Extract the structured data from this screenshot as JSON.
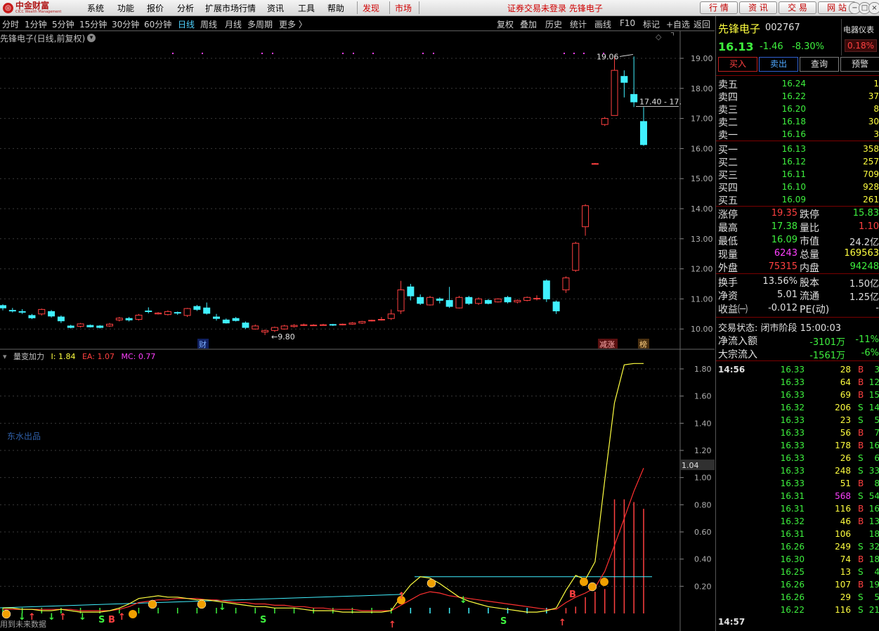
{
  "menubar": {
    "logo_text": "中金财富",
    "logo_sub": "CICC Wealth Management",
    "items": [
      "系统",
      "功能",
      "报价",
      "分析",
      "扩展市场行情",
      "资讯",
      "工具",
      "帮助"
    ],
    "faxian": "发现",
    "shichang": "市场",
    "notice": "证券交易未登录  先锋电子",
    "right_buttons": [
      "行 情",
      "资 讯",
      "交 易",
      "网 站"
    ],
    "win_buttons": [
      "−",
      "□",
      "×"
    ]
  },
  "toolbar": {
    "periods": [
      "分时",
      "1分钟",
      "5分钟",
      "15分钟",
      "30分钟",
      "60分钟",
      "日线",
      "周线",
      "月线",
      "多周期",
      "更多 〉"
    ],
    "active_period": "日线",
    "tools": [
      "复权",
      "叠加",
      "历史",
      "统计",
      "画线",
      "F10",
      "标记",
      "+自选",
      "返回"
    ]
  },
  "kline": {
    "title": "先锋电子(日线,前复权)",
    "high_label": "19.06",
    "low_label": "9.80",
    "range_label": "17.40 - 17.",
    "badge_cai": "财",
    "badge_jianzhang": "减涨",
    "badge_bang": "榜",
    "y_ticks": [
      "19.00",
      "18.00",
      "17.00",
      "16.00",
      "15.00",
      "14.00",
      "13.00",
      "12.00",
      "11.00",
      "10.00"
    ]
  },
  "indicator": {
    "name": "量变加力",
    "legend": [
      {
        "text": "I: 1.84",
        "color": "#ffff40"
      },
      {
        "text": "EA: 1.07",
        "color": "#ff4040"
      },
      {
        "text": "MC: 0.77",
        "color": "#ff40ff"
      }
    ],
    "y_ticks": [
      "1.80",
      "1.60",
      "1.40",
      "1.20",
      "1.00",
      "0.80",
      "0.60",
      "0.40",
      "0.20"
    ],
    "cursor_value": "1.04",
    "watermark": "东水出品",
    "footnote": "用到未来数据"
  },
  "quote": {
    "name": "先锋电子",
    "code": "002767",
    "price": "16.13",
    "change": "-1.46",
    "change_pct": "-8.30%",
    "meter_label": "电器仪表",
    "meter_value": "0.18%",
    "buttons": [
      "买入",
      "卖出",
      "查询",
      "预警"
    ],
    "asks": [
      {
        "label": "卖五",
        "price": "16.24",
        "vol": "1"
      },
      {
        "label": "卖四",
        "price": "16.22",
        "vol": "37"
      },
      {
        "label": "卖三",
        "price": "16.20",
        "vol": "8"
      },
      {
        "label": "卖二",
        "price": "16.18",
        "vol": "30"
      },
      {
        "label": "卖一",
        "price": "16.16",
        "vol": "3"
      }
    ],
    "bids": [
      {
        "label": "买一",
        "price": "16.13",
        "vol": "358"
      },
      {
        "label": "买二",
        "price": "16.12",
        "vol": "257"
      },
      {
        "label": "买三",
        "price": "16.11",
        "vol": "709"
      },
      {
        "label": "买四",
        "price": "16.10",
        "vol": "928"
      },
      {
        "label": "买五",
        "price": "16.09",
        "vol": "261"
      }
    ],
    "stats": [
      {
        "l1": "涨停",
        "v1": "19.35",
        "c1": "#ff4040",
        "l2": "跌停",
        "v2": "15.83",
        "c2": "#3ef03e"
      },
      {
        "l1": "最高",
        "v1": "17.38",
        "c1": "#3ef03e",
        "l2": "量比",
        "v2": "1.10",
        "c2": "#ff4040"
      },
      {
        "l1": "最低",
        "v1": "16.09",
        "c1": "#3ef03e",
        "l2": "市值",
        "v2": "24.2亿",
        "c2": "#e0e0e0"
      },
      {
        "l1": "现量",
        "v1": "6243",
        "c1": "#ff40ff",
        "l2": "总量",
        "v2": "169563",
        "c2": "#ffff40"
      },
      {
        "l1": "外盘",
        "v1": "75315",
        "c1": "#ff4040",
        "l2": "内盘",
        "v2": "94248",
        "c2": "#3ef03e"
      }
    ],
    "stats2": [
      {
        "l1": "换手",
        "v1": "13.56%",
        "c1": "#e0e0e0",
        "l2": "股本",
        "v2": "1.50亿",
        "c2": "#e0e0e0"
      },
      {
        "l1": "净资",
        "v1": "5.01",
        "c1": "#e0e0e0",
        "l2": "流通",
        "v2": "1.25亿",
        "c2": "#e0e0e0"
      },
      {
        "l1": "收益㈠",
        "v1": "-0.012",
        "c1": "#e0e0e0",
        "l2": "PE(动)",
        "v2": "-",
        "c2": "#e0e0e0"
      }
    ],
    "trade_state": "交易状态: 闭市阶段 15:00:03",
    "flows": [
      {
        "label": "净流入额",
        "value": "-3101万",
        "pct": "-11%"
      },
      {
        "label": "大宗流入",
        "value": "-1561万",
        "pct": "-6%"
      }
    ],
    "ticks_time_top": "14:56",
    "ticks_time_bottom": "14:57",
    "ticks": [
      {
        "p": "16.33",
        "v": "28",
        "bs": "B",
        "n": "3"
      },
      {
        "p": "16.33",
        "v": "64",
        "bs": "B",
        "n": "12"
      },
      {
        "p": "16.33",
        "v": "69",
        "bs": "B",
        "n": "15"
      },
      {
        "p": "16.32",
        "v": "206",
        "bs": "S",
        "n": "14"
      },
      {
        "p": "16.33",
        "v": "23",
        "bs": "S",
        "n": "5"
      },
      {
        "p": "16.33",
        "v": "56",
        "bs": "B",
        "n": "7"
      },
      {
        "p": "16.33",
        "v": "178",
        "bs": "B",
        "n": "16"
      },
      {
        "p": "16.33",
        "v": "26",
        "bs": "S",
        "n": "6"
      },
      {
        "p": "16.33",
        "v": "248",
        "bs": "S",
        "n": "33"
      },
      {
        "p": "16.33",
        "v": "51",
        "bs": "B",
        "n": "8"
      },
      {
        "p": "16.31",
        "v": "568",
        "bs": "S",
        "n": "54"
      },
      {
        "p": "16.31",
        "v": "116",
        "bs": "B",
        "n": "16"
      },
      {
        "p": "16.32",
        "v": "46",
        "bs": "B",
        "n": "13"
      },
      {
        "p": "16.31",
        "v": "106",
        "bs": "",
        "n": "18"
      },
      {
        "p": "16.26",
        "v": "249",
        "bs": "S",
        "n": "32"
      },
      {
        "p": "16.30",
        "v": "74",
        "bs": "B",
        "n": "18"
      },
      {
        "p": "16.25",
        "v": "13",
        "bs": "S",
        "n": "4"
      },
      {
        "p": "16.26",
        "v": "107",
        "bs": "B",
        "n": "19"
      },
      {
        "p": "16.26",
        "v": "29",
        "bs": "S",
        "n": "5"
      },
      {
        "p": "16.22",
        "v": "116",
        "bs": "S",
        "n": "21"
      }
    ]
  },
  "colors": {
    "up": "#ff4040",
    "down": "#40f0ff",
    "green": "#3ef03e",
    "yellow": "#ffff40",
    "magenta": "#ff40ff",
    "cyan": "#40f0ff"
  }
}
